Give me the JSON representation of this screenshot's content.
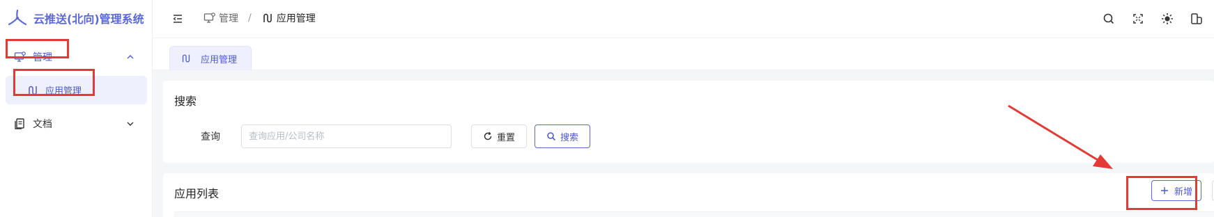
{
  "app": {
    "title": "云推送(北向)管理系统"
  },
  "sidebar": {
    "group_label": "管理",
    "active_item_label": "应用管理",
    "doc_label": "文档"
  },
  "breadcrumb": {
    "first": "管理",
    "separator": "/",
    "current": "应用管理"
  },
  "tabs": [
    {
      "label": "应用管理"
    }
  ],
  "search_card": {
    "title": "搜索",
    "query_label": "查询",
    "query_placeholder": "查询应用/公司名称",
    "reset_label": "重置",
    "search_label": "搜索"
  },
  "list_card": {
    "title": "应用列表",
    "add_label": "新增"
  },
  "colors": {
    "accent": "#5b68d8",
    "highlight_red": "#e53935"
  },
  "icons": [
    "logo-icon",
    "monitor-gear-icon",
    "chevron-up-icon",
    "route-icon",
    "document-icon",
    "chevron-down-icon",
    "menu-fold-icon",
    "search-icon",
    "fullscreen-icon",
    "theme-sun-icon",
    "layout-icon",
    "refresh-icon",
    "plus-icon"
  ]
}
